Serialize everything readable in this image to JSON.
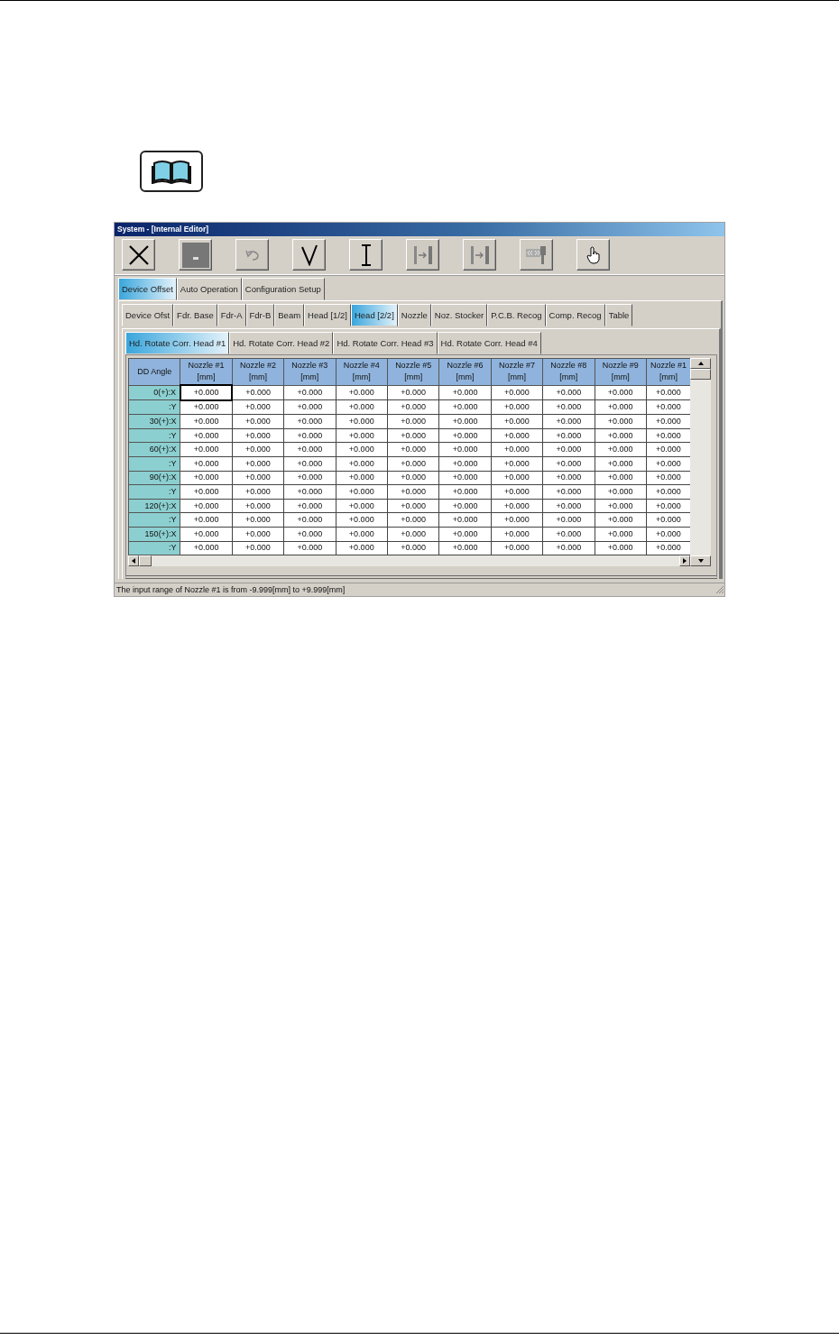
{
  "window": {
    "title": "System - [Internal Editor]"
  },
  "toolbar": [
    {
      "kind": "close",
      "disabled": false
    },
    {
      "kind": "stop",
      "disabled": false
    },
    {
      "kind": "undo",
      "disabled": true
    },
    {
      "kind": "check",
      "disabled": false
    },
    {
      "kind": "cursor",
      "disabled": false
    },
    {
      "kind": "jump",
      "disabled": true
    },
    {
      "kind": "jump",
      "disabled": true
    },
    {
      "kind": "device",
      "disabled": true
    },
    {
      "kind": "hand",
      "disabled": false
    }
  ],
  "main_tabs": [
    {
      "label": "Device Offset",
      "selected": true
    },
    {
      "label": "Auto Operation",
      "selected": false
    },
    {
      "label": "Configuration Setup",
      "selected": false
    }
  ],
  "sub_tabs": [
    {
      "label": "Device Ofst",
      "selected": false
    },
    {
      "label": "Fdr. Base",
      "selected": false
    },
    {
      "label": "Fdr-A",
      "selected": false
    },
    {
      "label": "Fdr-B",
      "selected": false
    },
    {
      "label": "Beam",
      "selected": false
    },
    {
      "label": "Head [1/2]",
      "selected": false
    },
    {
      "label": "Head [2/2]",
      "selected": true
    },
    {
      "label": "Nozzle",
      "selected": false
    },
    {
      "label": "Noz. Stocker",
      "selected": false
    },
    {
      "label": "P.C.B. Recog",
      "selected": false
    },
    {
      "label": "Comp. Recog",
      "selected": false
    },
    {
      "label": "Table",
      "selected": false
    }
  ],
  "head_tabs": [
    {
      "label": "Hd. Rotate Corr.  Head #1",
      "selected": true
    },
    {
      "label": "Hd. Rotate Corr.  Head #2",
      "selected": false
    },
    {
      "label": "Hd. Rotate Corr.  Head #3",
      "selected": false
    },
    {
      "label": "Hd. Rotate Corr.  Head #4",
      "selected": false
    }
  ],
  "table": {
    "corner": "DD Angle",
    "columns": [
      {
        "label": "Nozzle #1",
        "unit": "[mm]"
      },
      {
        "label": "Nozzle #2",
        "unit": "[mm]"
      },
      {
        "label": "Nozzle #3",
        "unit": "[mm]"
      },
      {
        "label": "Nozzle #4",
        "unit": "[mm]"
      },
      {
        "label": "Nozzle #5",
        "unit": "[mm]"
      },
      {
        "label": "Nozzle #6",
        "unit": "[mm]"
      },
      {
        "label": "Nozzle #7",
        "unit": "[mm]"
      },
      {
        "label": "Nozzle #8",
        "unit": "[mm]"
      },
      {
        "label": "Nozzle #9",
        "unit": "[mm]"
      },
      {
        "label": "Nozzle #1",
        "unit": "[mm]"
      }
    ],
    "rows": [
      {
        "label": "0(+):X",
        "cells": [
          {
            "value": "+0.000",
            "focused": true
          },
          {
            "value": "+0.000",
            "focused": false
          },
          {
            "value": "+0.000",
            "focused": false
          },
          {
            "value": "+0.000",
            "focused": false
          },
          {
            "value": "+0.000",
            "focused": false
          },
          {
            "value": "+0.000",
            "focused": false
          },
          {
            "value": "+0.000",
            "focused": false
          },
          {
            "value": "+0.000",
            "focused": false
          },
          {
            "value": "+0.000",
            "focused": false
          },
          {
            "value": "+0.000",
            "focused": false
          }
        ]
      },
      {
        "label": ":Y",
        "cells": [
          {
            "value": "+0.000",
            "focused": false
          },
          {
            "value": "+0.000",
            "focused": false
          },
          {
            "value": "+0.000",
            "focused": false
          },
          {
            "value": "+0.000",
            "focused": false
          },
          {
            "value": "+0.000",
            "focused": false
          },
          {
            "value": "+0.000",
            "focused": false
          },
          {
            "value": "+0.000",
            "focused": false
          },
          {
            "value": "+0.000",
            "focused": false
          },
          {
            "value": "+0.000",
            "focused": false
          },
          {
            "value": "+0.000",
            "focused": false
          }
        ]
      },
      {
        "label": "30(+):X",
        "cells": [
          {
            "value": "+0.000",
            "focused": false
          },
          {
            "value": "+0.000",
            "focused": false
          },
          {
            "value": "+0.000",
            "focused": false
          },
          {
            "value": "+0.000",
            "focused": false
          },
          {
            "value": "+0.000",
            "focused": false
          },
          {
            "value": "+0.000",
            "focused": false
          },
          {
            "value": "+0.000",
            "focused": false
          },
          {
            "value": "+0.000",
            "focused": false
          },
          {
            "value": "+0.000",
            "focused": false
          },
          {
            "value": "+0.000",
            "focused": false
          }
        ]
      },
      {
        "label": ":Y",
        "cells": [
          {
            "value": "+0.000",
            "focused": false
          },
          {
            "value": "+0.000",
            "focused": false
          },
          {
            "value": "+0.000",
            "focused": false
          },
          {
            "value": "+0.000",
            "focused": false
          },
          {
            "value": "+0.000",
            "focused": false
          },
          {
            "value": "+0.000",
            "focused": false
          },
          {
            "value": "+0.000",
            "focused": false
          },
          {
            "value": "+0.000",
            "focused": false
          },
          {
            "value": "+0.000",
            "focused": false
          },
          {
            "value": "+0.000",
            "focused": false
          }
        ]
      },
      {
        "label": "60(+):X",
        "cells": [
          {
            "value": "+0.000",
            "focused": false
          },
          {
            "value": "+0.000",
            "focused": false
          },
          {
            "value": "+0.000",
            "focused": false
          },
          {
            "value": "+0.000",
            "focused": false
          },
          {
            "value": "+0.000",
            "focused": false
          },
          {
            "value": "+0.000",
            "focused": false
          },
          {
            "value": "+0.000",
            "focused": false
          },
          {
            "value": "+0.000",
            "focused": false
          },
          {
            "value": "+0.000",
            "focused": false
          },
          {
            "value": "+0.000",
            "focused": false
          }
        ]
      },
      {
        "label": ":Y",
        "cells": [
          {
            "value": "+0.000",
            "focused": false
          },
          {
            "value": "+0.000",
            "focused": false
          },
          {
            "value": "+0.000",
            "focused": false
          },
          {
            "value": "+0.000",
            "focused": false
          },
          {
            "value": "+0.000",
            "focused": false
          },
          {
            "value": "+0.000",
            "focused": false
          },
          {
            "value": "+0.000",
            "focused": false
          },
          {
            "value": "+0.000",
            "focused": false
          },
          {
            "value": "+0.000",
            "focused": false
          },
          {
            "value": "+0.000",
            "focused": false
          }
        ]
      },
      {
        "label": "90(+):X",
        "cells": [
          {
            "value": "+0.000",
            "focused": false
          },
          {
            "value": "+0.000",
            "focused": false
          },
          {
            "value": "+0.000",
            "focused": false
          },
          {
            "value": "+0.000",
            "focused": false
          },
          {
            "value": "+0.000",
            "focused": false
          },
          {
            "value": "+0.000",
            "focused": false
          },
          {
            "value": "+0.000",
            "focused": false
          },
          {
            "value": "+0.000",
            "focused": false
          },
          {
            "value": "+0.000",
            "focused": false
          },
          {
            "value": "+0.000",
            "focused": false
          }
        ]
      },
      {
        "label": ":Y",
        "cells": [
          {
            "value": "+0.000",
            "focused": false
          },
          {
            "value": "+0.000",
            "focused": false
          },
          {
            "value": "+0.000",
            "focused": false
          },
          {
            "value": "+0.000",
            "focused": false
          },
          {
            "value": "+0.000",
            "focused": false
          },
          {
            "value": "+0.000",
            "focused": false
          },
          {
            "value": "+0.000",
            "focused": false
          },
          {
            "value": "+0.000",
            "focused": false
          },
          {
            "value": "+0.000",
            "focused": false
          },
          {
            "value": "+0.000",
            "focused": false
          }
        ]
      },
      {
        "label": "120(+):X",
        "cells": [
          {
            "value": "+0.000",
            "focused": false
          },
          {
            "value": "+0.000",
            "focused": false
          },
          {
            "value": "+0.000",
            "focused": false
          },
          {
            "value": "+0.000",
            "focused": false
          },
          {
            "value": "+0.000",
            "focused": false
          },
          {
            "value": "+0.000",
            "focused": false
          },
          {
            "value": "+0.000",
            "focused": false
          },
          {
            "value": "+0.000",
            "focused": false
          },
          {
            "value": "+0.000",
            "focused": false
          },
          {
            "value": "+0.000",
            "focused": false
          }
        ]
      },
      {
        "label": ":Y",
        "cells": [
          {
            "value": "+0.000",
            "focused": false
          },
          {
            "value": "+0.000",
            "focused": false
          },
          {
            "value": "+0.000",
            "focused": false
          },
          {
            "value": "+0.000",
            "focused": false
          },
          {
            "value": "+0.000",
            "focused": false
          },
          {
            "value": "+0.000",
            "focused": false
          },
          {
            "value": "+0.000",
            "focused": false
          },
          {
            "value": "+0.000",
            "focused": false
          },
          {
            "value": "+0.000",
            "focused": false
          },
          {
            "value": "+0.000",
            "focused": false
          }
        ]
      },
      {
        "label": "150(+):X",
        "cells": [
          {
            "value": "+0.000",
            "focused": false
          },
          {
            "value": "+0.000",
            "focused": false
          },
          {
            "value": "+0.000",
            "focused": false
          },
          {
            "value": "+0.000",
            "focused": false
          },
          {
            "value": "+0.000",
            "focused": false
          },
          {
            "value": "+0.000",
            "focused": false
          },
          {
            "value": "+0.000",
            "focused": false
          },
          {
            "value": "+0.000",
            "focused": false
          },
          {
            "value": "+0.000",
            "focused": false
          },
          {
            "value": "+0.000",
            "focused": false
          }
        ]
      },
      {
        "label": ":Y",
        "cells": [
          {
            "value": "+0.000",
            "focused": false
          },
          {
            "value": "+0.000",
            "focused": false
          },
          {
            "value": "+0.000",
            "focused": false
          },
          {
            "value": "+0.000",
            "focused": false
          },
          {
            "value": "+0.000",
            "focused": false
          },
          {
            "value": "+0.000",
            "focused": false
          },
          {
            "value": "+0.000",
            "focused": false
          },
          {
            "value": "+0.000",
            "focused": false
          },
          {
            "value": "+0.000",
            "focused": false
          },
          {
            "value": "+0.000",
            "focused": false
          }
        ]
      }
    ]
  },
  "status_bar": "The input range of Nozzle #1  is from  -9.999[mm]  to  +9.999[mm]"
}
